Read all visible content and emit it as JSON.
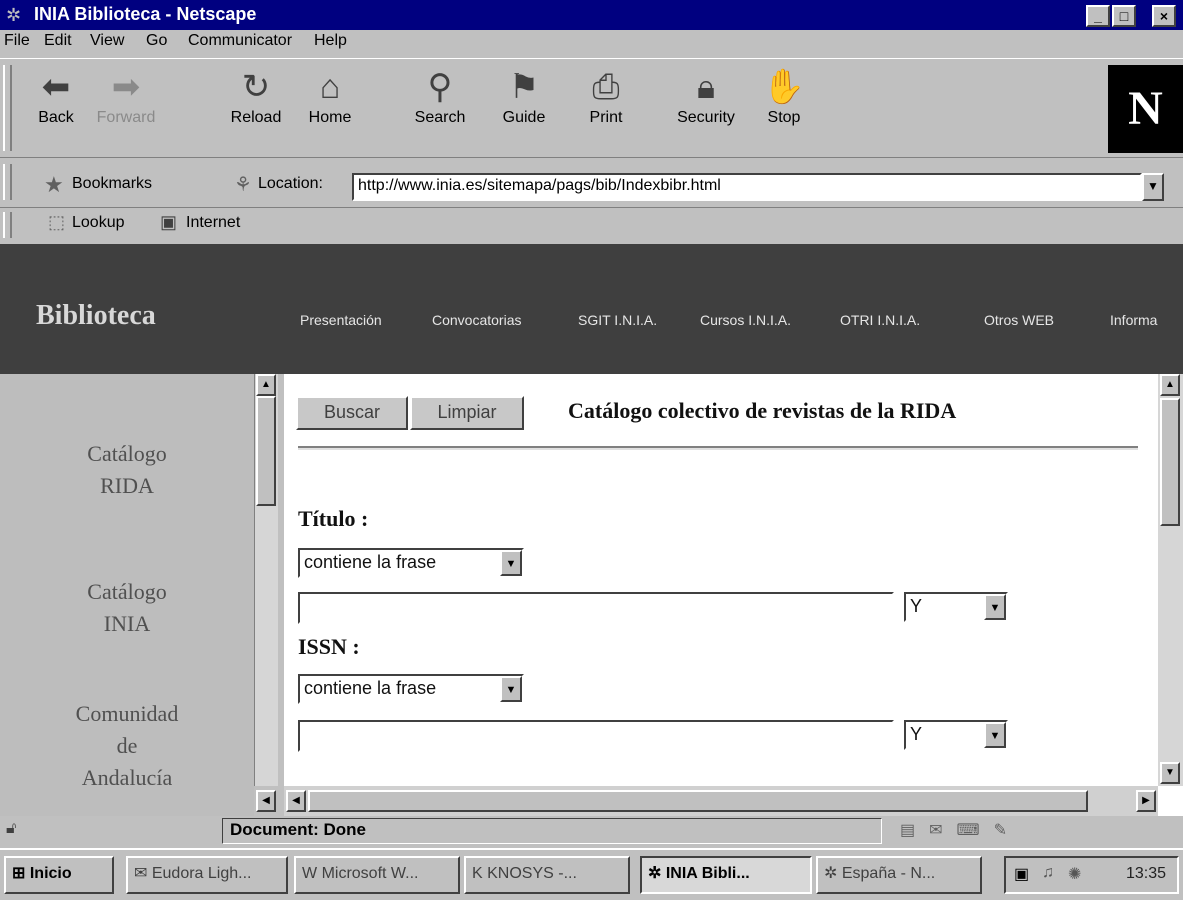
{
  "window": {
    "title": "INIA Biblioteca - Netscape",
    "min": "_",
    "max": "□",
    "close": "×"
  },
  "menu": [
    "File",
    "Edit",
    "View",
    "Go",
    "Communicator",
    "Help"
  ],
  "toolbar": {
    "buttons": [
      {
        "label": "Back",
        "icon": "back-arrow-icon",
        "enabled": true
      },
      {
        "label": "Forward",
        "icon": "forward-arrow-icon",
        "enabled": false
      },
      {
        "label": "Reload",
        "icon": "reload-icon",
        "enabled": true
      },
      {
        "label": "Home",
        "icon": "home-icon",
        "enabled": true
      },
      {
        "label": "Search",
        "icon": "search-icon",
        "enabled": true
      },
      {
        "label": "Guide",
        "icon": "guide-icon",
        "enabled": true
      },
      {
        "label": "Print",
        "icon": "print-icon",
        "enabled": true
      },
      {
        "label": "Security",
        "icon": "security-lock-icon",
        "enabled": true
      },
      {
        "label": "Stop",
        "icon": "stop-icon",
        "enabled": true
      }
    ],
    "logo": "N"
  },
  "location": {
    "bookmarks_label": "Bookmarks",
    "location_label": "Location:",
    "url": "http://www.inia.es/sitemapa/pags/bib/Indexbibr.html"
  },
  "personal_bar": [
    "Lookup",
    "Internet"
  ],
  "banner": {
    "brand": "Biblioteca",
    "nav": [
      "Presentación",
      "Convocatorias",
      "SGIT I.N.I.A.",
      "Cursos I.N.I.A.",
      "OTRI I.N.I.A.",
      "Otros WEB",
      "Informa"
    ]
  },
  "left_frame": {
    "items": [
      {
        "line1": "Catálogo",
        "line2": "RIDA"
      },
      {
        "line1": "Catálogo",
        "line2": "INIA"
      },
      {
        "line1": "Comunidad",
        "line2": "de",
        "line3": "Andalucía"
      }
    ]
  },
  "form": {
    "search_button": "Buscar",
    "clear_button": "Limpiar",
    "title": "Catálogo colectivo de revistas de la RIDA",
    "fields": [
      {
        "label": "Título :",
        "operator": "contiene la frase",
        "value": "",
        "connector": "Y"
      },
      {
        "label": "ISSN :",
        "operator": "contiene la frase",
        "value": "",
        "connector": "Y"
      }
    ]
  },
  "status": {
    "text": "Document: Done"
  },
  "taskbar": {
    "start": "Inicio",
    "tasks": [
      "Eudora Ligh...",
      "Microsoft W...",
      "KNOSYS -...",
      "INIA Bibli...",
      "España - N..."
    ],
    "clock": "13:35"
  }
}
